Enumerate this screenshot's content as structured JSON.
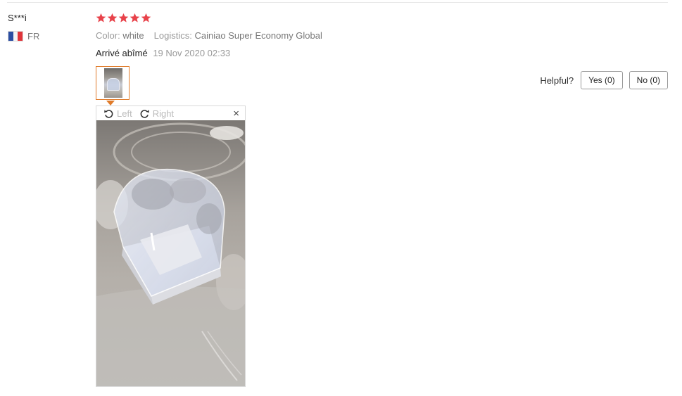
{
  "review": {
    "user_name": "S***i",
    "country_code": "FR",
    "rating": 5,
    "color_label": "Color:",
    "color_value": "white",
    "logistics_label": "Logistics:",
    "logistics_value": "Cainiao Super Economy Global",
    "text": "Arrivé abîmé",
    "date": "19 Nov 2020 02:33"
  },
  "viewer": {
    "rotate_left_label": "Left",
    "rotate_right_label": "Right",
    "close_glyph": "×"
  },
  "helpful": {
    "label": "Helpful?",
    "yes_label": "Yes (0)",
    "no_label": "No (0)"
  },
  "colors": {
    "star": "#e8424a",
    "thumb_border": "#e07b2a"
  },
  "icons": [
    "star-icon",
    "france-flag-icon",
    "rotate-left-icon",
    "rotate-right-icon",
    "close-icon"
  ]
}
